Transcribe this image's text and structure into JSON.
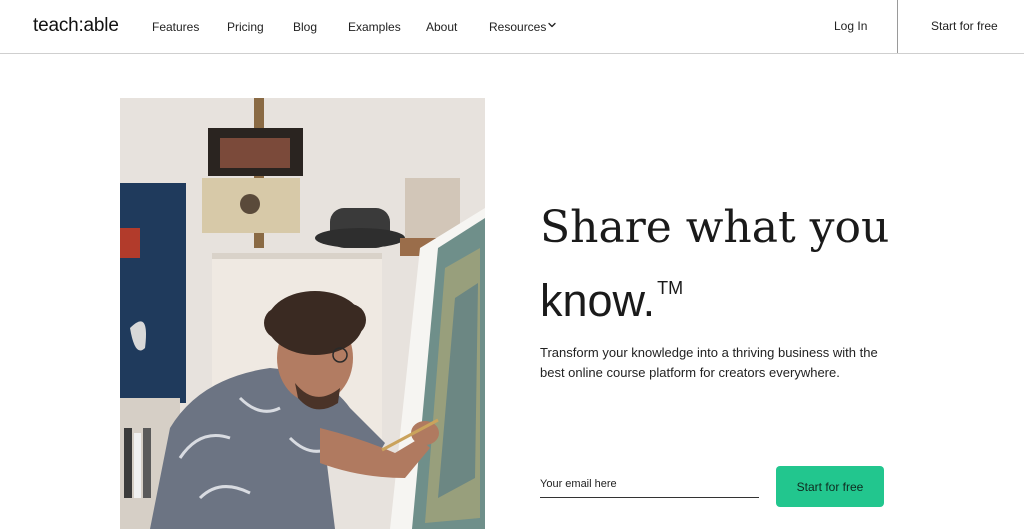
{
  "nav": {
    "logo": "teach:able",
    "links": {
      "features": "Features",
      "pricing": "Pricing",
      "blog": "Blog",
      "examples": "Examples",
      "about": "About",
      "resources": "Resources"
    },
    "resources_icon": "chevron-down-icon",
    "login": "Log In",
    "start": "Start for free"
  },
  "hero": {
    "headline_line1": "Share what you",
    "headline_line2": "know.",
    "trademark": "TM",
    "subtext": "Transform your knowledge into a thriving business with the best online course platform for creators everywhere.",
    "email_placeholder": "Your email here",
    "cta": "Start for free",
    "image_description": "artist-painting-photo"
  },
  "colors": {
    "accent": "#22c68e",
    "text": "#1a1a1a",
    "divider": "#cfcfcf"
  }
}
